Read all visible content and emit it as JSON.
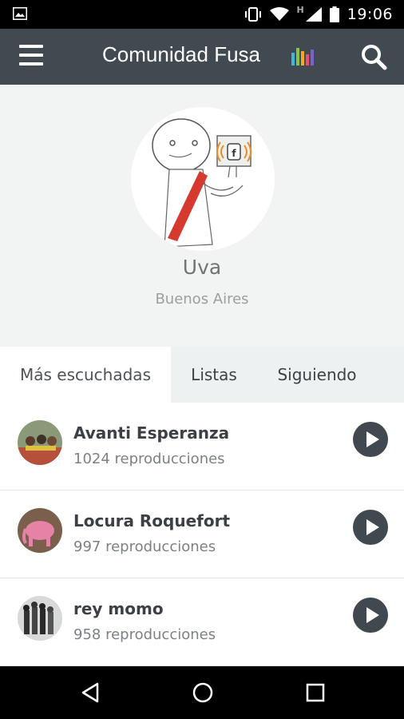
{
  "status_bar": {
    "time": "19:06",
    "network_letter": "H",
    "icons": [
      "image-icon",
      "vibrate-icon",
      "wifi-icon",
      "signal-icon",
      "battery-icon"
    ]
  },
  "app_bar": {
    "title": "Comunidad Fusa",
    "icons": [
      "menu-icon",
      "bars-chart-icon",
      "search-icon"
    ],
    "bar_colors": [
      "#3db8d8",
      "#8bc34a",
      "#f5a623",
      "#e94e77",
      "#7b61c9"
    ]
  },
  "profile": {
    "name": "Uva",
    "location": "Buenos Aires",
    "avatar": "stick-figure-with-fusa-sign"
  },
  "tabs": [
    {
      "label": "Más escuchadas",
      "active": true
    },
    {
      "label": "Listas",
      "active": false
    },
    {
      "label": "Siguiendo",
      "active": false
    }
  ],
  "tracks": [
    {
      "title": "Avanti Esperanza",
      "plays": "1024 reproducciones",
      "thumb_color": "#b5503a"
    },
    {
      "title": "Locura Roquefort",
      "plays": "997 reproducciones",
      "thumb_color": "#c96b86"
    },
    {
      "title": "rey momo",
      "plays": "958 reproducciones",
      "thumb_color": "#555a5c"
    }
  ],
  "nav_bar": {
    "icons": [
      "back-icon",
      "home-icon",
      "recent-apps-icon"
    ]
  }
}
